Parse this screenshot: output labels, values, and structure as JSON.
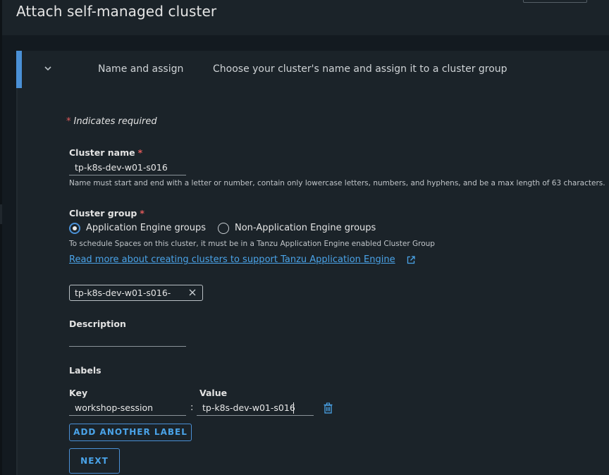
{
  "header": {
    "title": "Attach self-managed cluster"
  },
  "step": {
    "name": "Name and assign",
    "description": "Choose your cluster's name and assign it to a cluster group"
  },
  "form": {
    "required_star": "*",
    "required_note": "Indicates required",
    "cluster_name": {
      "label": "Cluster name",
      "value": "tp-k8s-dev-w01-s016",
      "helper": "Name must start and end with a letter or number, contain only lowercase letters, numbers, and hyphens, and be a max length of 63 characters."
    },
    "cluster_group": {
      "label": "Cluster group",
      "options": [
        {
          "label": "Application Engine groups",
          "checked": true
        },
        {
          "label": "Non-Application Engine groups",
          "checked": false
        }
      ],
      "helper": "To schedule Spaces on this cluster, it must be in a Tanzu Application Engine enabled Cluster Group",
      "link": "Read more about creating clusters to support Tanzu Application Engine",
      "selected_group": "tp-k8s-dev-w01-s016-"
    },
    "description": {
      "label": "Description",
      "value": ""
    },
    "labels": {
      "title": "Labels",
      "key_header": "Key",
      "value_header": "Value",
      "separator": ":",
      "items": [
        {
          "key": "workshop-session",
          "value": "tp-k8s-dev-w01-s016"
        }
      ],
      "add_button": "ADD ANOTHER LABEL"
    },
    "next_button": "NEXT"
  },
  "colors": {
    "accent": "#4a90d6",
    "link": "#4aa3e8",
    "required": "#e05a5a",
    "panel": "#1b2329",
    "background": "#131a20"
  }
}
